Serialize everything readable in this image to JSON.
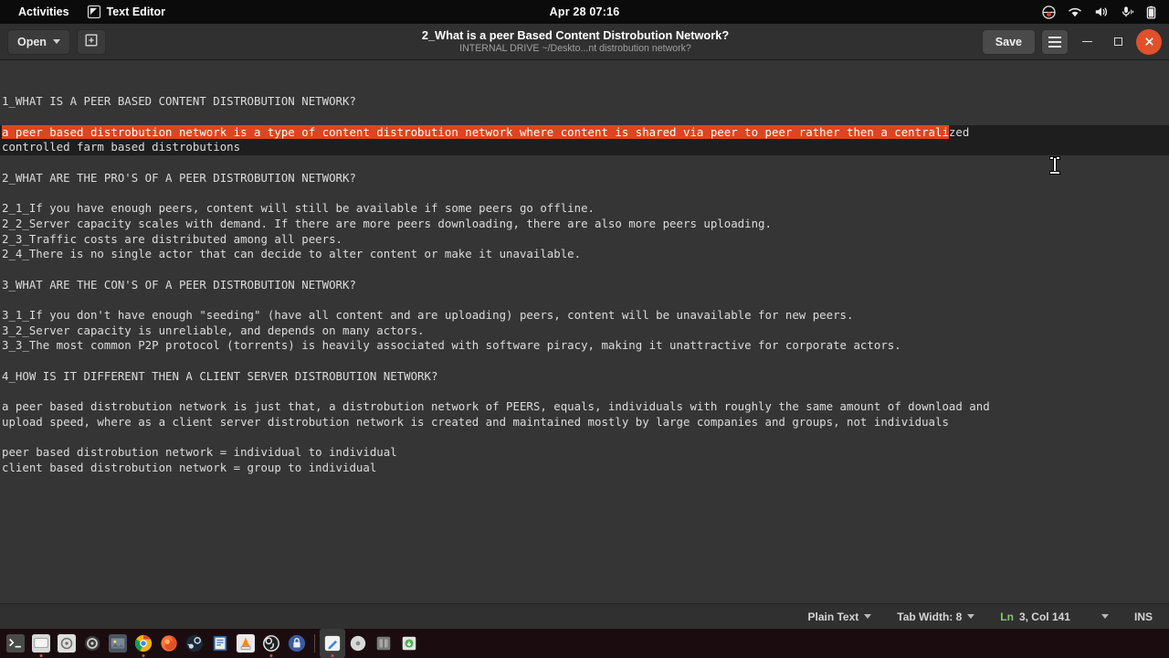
{
  "topbar": {
    "activities": "Activities",
    "app_name": "Text Editor",
    "app_icon": "text-editor-icon",
    "clock": "Apr 28  07:16",
    "tray": [
      {
        "name": "recording-indicator-icon"
      },
      {
        "name": "wifi-icon"
      },
      {
        "name": "volume-icon"
      },
      {
        "name": "microphone-icon"
      },
      {
        "name": "battery-icon"
      }
    ]
  },
  "headerbar": {
    "open_label": "Open",
    "new_document_icon": "new-document-icon",
    "title": "2_What is a peer Based Content Distrobution Network?",
    "subtitle": "INTERNAL DRIVE ~/Deskto...nt distrobution network?",
    "save_label": "Save",
    "menu_icon": "hamburger-menu-icon",
    "minimize_icon": "minimize-icon",
    "maximize_icon": "maximize-icon",
    "close_icon": "close-icon",
    "close_color": "#e0502a"
  },
  "editor": {
    "selection_color": "#e0431f",
    "current_line_color": "#1e1e1e",
    "background": "#353535",
    "text_color": "#dcdcdc",
    "lines": [
      {
        "text": "1_WHAT IS A PEER BASED CONTENT DISTROBUTION NETWORK?"
      },
      {
        "text": ""
      },
      {
        "text": "a peer based distrobution network is a type of content distrobution network where content is shared via peer to peer rather then a centralized",
        "selected_prefix": "a peer based distrobution network is a type of content distrobution network where content is shared via peer to peer rather then a centrali",
        "selected_suffix": "zed",
        "current": true
      },
      {
        "text": "controlled farm based distrobutions",
        "current": true
      },
      {
        "text": ""
      },
      {
        "text": "2_WHAT ARE THE PRO'S OF A PEER DISTROBUTION NETWORK?"
      },
      {
        "text": ""
      },
      {
        "text": "2_1_If you have enough peers, content will still be available if some peers go offline."
      },
      {
        "text": "2_2_Server capacity scales with demand. If there are more peers downloading, there are also more peers uploading."
      },
      {
        "text": "2_3_Traffic costs are distributed among all peers."
      },
      {
        "text": "2_4_There is no single actor that can decide to alter content or make it unavailable."
      },
      {
        "text": ""
      },
      {
        "text": "3_WHAT ARE THE CON'S OF A PEER DISTROBUTION NETWORK?"
      },
      {
        "text": ""
      },
      {
        "text": "3_1_If you don't have enough \"seeding\" (have all content and are uploading) peers, content will be unavailable for new peers."
      },
      {
        "text": "3_2_Server capacity is unreliable, and depends on many actors."
      },
      {
        "text": "3_3_The most common P2P protocol (torrents) is heavily associated with software piracy, making it unattractive for corporate actors."
      },
      {
        "text": ""
      },
      {
        "text": "4_HOW IS IT DIFFERENT THEN A CLIENT SERVER DISTROBUTION NETWORK?"
      },
      {
        "text": ""
      },
      {
        "text": "a peer based distrobution network is just that, a distrobution network of PEERS, equals, individuals with roughly the same amount of download and"
      },
      {
        "text": "upload speed, where as a client server distrobution network is created and maintained mostly by large companies and groups, not individuals"
      },
      {
        "text": ""
      },
      {
        "text": "peer based distrobution network = individual to individual"
      },
      {
        "text": "client based distrobution network = group to individual"
      }
    ]
  },
  "statusbar": {
    "language": "Plain Text",
    "tab_width": "Tab Width: 8",
    "ln_prefix": "Ln",
    "position": "3, Col 141",
    "insert_mode": "INS"
  },
  "dock": {
    "items": [
      {
        "name": "terminal-icon",
        "running": false
      },
      {
        "name": "file-manager-icon",
        "running": true
      },
      {
        "name": "disk-utility-icon",
        "running": false
      },
      {
        "name": "settings-icon",
        "running": false
      },
      {
        "name": "image-viewer-icon",
        "running": false
      },
      {
        "name": "google-chrome-icon",
        "running": true
      },
      {
        "name": "firefox-icon",
        "running": false
      },
      {
        "name": "steam-icon",
        "running": false
      },
      {
        "name": "libreoffice-writer-icon",
        "running": false
      },
      {
        "name": "vlc-icon",
        "running": false
      },
      {
        "name": "obs-studio-icon",
        "running": true
      },
      {
        "name": "authenticator-icon",
        "running": false
      },
      {
        "name": "separator",
        "running": false
      },
      {
        "name": "text-editor-icon",
        "running": true,
        "active": true
      },
      {
        "name": "disc-icon",
        "running": false
      },
      {
        "name": "archive-manager-icon",
        "running": false
      },
      {
        "name": "software-installer-icon",
        "running": false
      }
    ]
  }
}
